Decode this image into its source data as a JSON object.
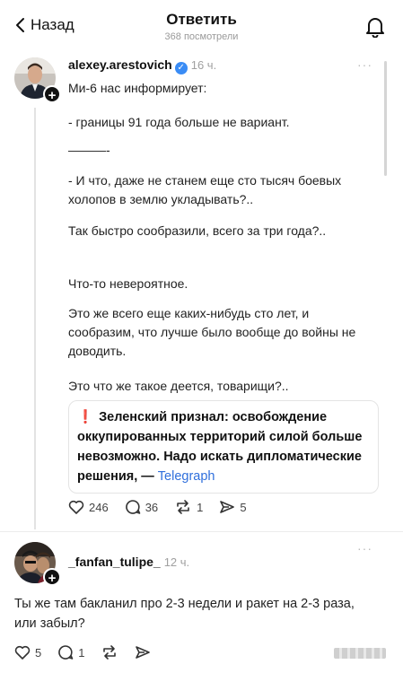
{
  "header": {
    "back_label": "Назад",
    "title": "Ответить",
    "views": "368 посмотрели"
  },
  "post": {
    "username": "alexey.arestovich",
    "time": "16 ч.",
    "more": "···",
    "paragraphs": [
      "Ми-6 нас информирует:",
      "- границы 91 года больше не вариант.",
      "———-",
      "- И что, даже не станем еще сто тысяч боевых холопов в землю укладывать?..",
      "Так быстро сообразили, всего за три года?..",
      "Что-то невероятное.",
      "Это же всего еще каких-нибудь сто лет, и сообразим, что лучше было вообще до войны не доводить.",
      "Это что же такое деется, товарищи?.."
    ],
    "quote": {
      "mark": "❗",
      "text": "Зеленский признал: освобождение оккупированных территорий силой больше невозможно. Надо искать дипломатические решения, —",
      "source": "Telegraph"
    },
    "counts": {
      "likes": "246",
      "comments": "36",
      "reposts": "1",
      "shares": "5"
    }
  },
  "reply": {
    "username": "_fanfan_tulipe_",
    "time": "12 ч.",
    "more": "···",
    "text": "Ты же там бакланил про 2-3 недели и ракет на 2-3 раза, или забыл?",
    "counts": {
      "likes": "5",
      "comments": "1"
    }
  }
}
